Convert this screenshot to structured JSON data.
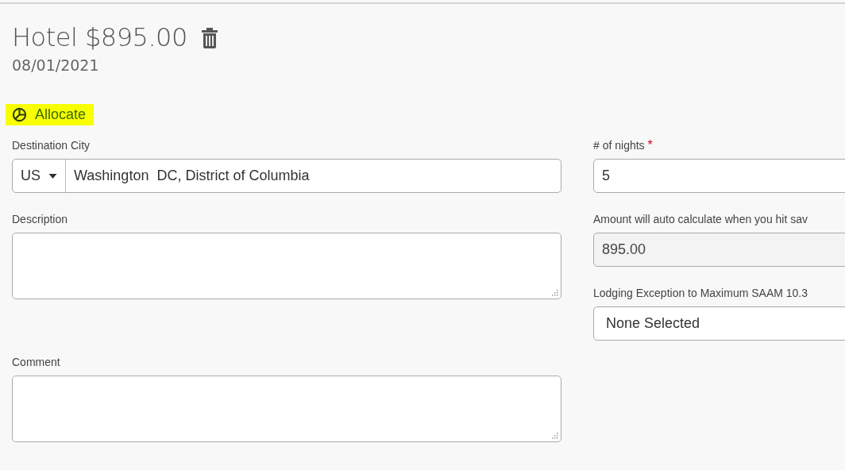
{
  "header": {
    "title": "Hotel $895.00",
    "date": "08/01/2021"
  },
  "allocate": {
    "label": "Allocate",
    "highlighted": true
  },
  "left_fields": [
    {
      "kind": "city",
      "label": "Destination City",
      "country": "US",
      "value": "Washington  DC, District of Columbia"
    },
    {
      "kind": "textarea",
      "label": "Description"
    },
    {
      "kind": "textarea",
      "label": "Comment"
    }
  ],
  "right_fields": [
    {
      "kind": "input",
      "label": "# of nights",
      "required": true,
      "required_mark": "*",
      "value": "5",
      "disabled": false
    },
    {
      "kind": "input",
      "label": "Amount will auto calculate when you hit sav",
      "required": false,
      "value": "895.00",
      "disabled": true
    },
    {
      "kind": "select",
      "label": "Lodging Exception to Maximum SAAM 10.3",
      "required": false,
      "value": "None Selected",
      "disabled": false
    }
  ]
}
